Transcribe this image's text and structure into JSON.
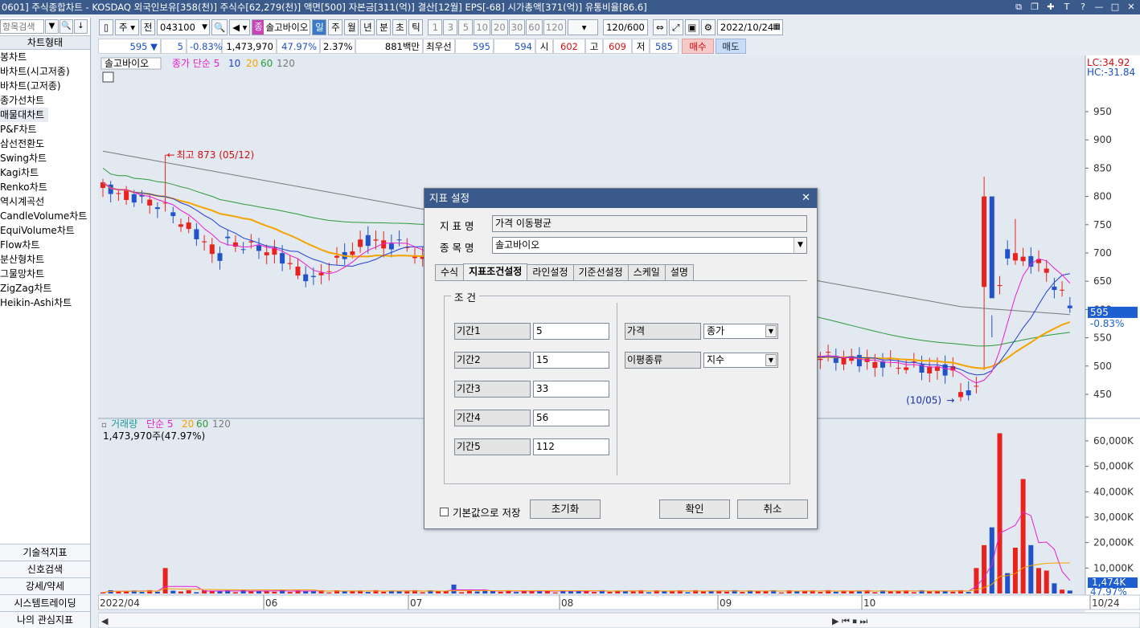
{
  "titlebar": {
    "text": "0601] 주식종합차트 - KOSDAQ 외국인보유[358(천)] 주식수[62,279(천)] 액면[500] 자본금[311(억)] 결산[12월] EPS[-68] 시가총액[371(억)] 유통비율[86.6]",
    "controls": [
      "⧉",
      "❐",
      "✚",
      "T",
      "?",
      "—",
      "□",
      "✕"
    ]
  },
  "sidebar": {
    "search_placeholder": "항목검색",
    "header": "차트형태",
    "items": [
      "봉차트",
      "바차트(시고저종)",
      "바차트(고저종)",
      "종가선차트",
      "매물대차트",
      "P&F차트",
      "삼선전환도",
      "Swing차트",
      "Kagi차트",
      "Renko차트",
      "역시계곡선",
      "CandleVolume차트",
      "EquiVolume차트",
      "Flow차트",
      "분산형차트",
      "그물망차트",
      "ZigZag차트",
      "Heikin-Ashi차트"
    ],
    "selected_index": 4,
    "bottom": [
      "기술적지표",
      "신호검색",
      "강세/약세",
      "시스템트레이딩",
      "나의 관심지표"
    ]
  },
  "toolbar": {
    "period": "주",
    "prev_label": "전",
    "code": "043100",
    "name_badge": "종",
    "stock_name": "솔고바이오",
    "units": [
      "일",
      "주",
      "월",
      "년",
      "분",
      "초",
      "틱"
    ],
    "active_unit": "일",
    "numbers": [
      "1",
      "3",
      "5",
      "10",
      "20",
      "30",
      "60",
      "120"
    ],
    "count": "120",
    "count_total": "/600",
    "date": "2022/10/24"
  },
  "quote": {
    "price": "595",
    "change": "5",
    "change_rate": "-0.83%",
    "volume": "1,473,970",
    "volume_ratio": "47.97%",
    "turnover": "2.37%",
    "amount": "881백만",
    "best_label": "최우선",
    "ask": "595",
    "bid": "594",
    "open_label": "시",
    "open": "602",
    "high_label": "고",
    "high": "609",
    "low_label": "저",
    "low": "585",
    "buy_label": "매수",
    "sell_label": "매도"
  },
  "price_panel": {
    "legend_name": "솔고바이오",
    "legend_ma": "종가 단순 5",
    "legend_periods": [
      "10",
      "20",
      "60",
      "120"
    ],
    "high_annotation": "최고 873 (05/12)",
    "low_annotation": "(10/05)",
    "lc": "LC:34.92",
    "hc": "HC:-31.84",
    "y_ticks": [
      "950",
      "900",
      "850",
      "800",
      "750",
      "700",
      "650",
      "600",
      "550",
      "500",
      "450"
    ],
    "current_price": "595",
    "current_change": "-0.83%"
  },
  "volume_panel": {
    "legend_name": "거래량",
    "legend_ma": "단순 5",
    "legend_periods": [
      "20",
      "60",
      "120"
    ],
    "value": "1,473,970주(47.97%)",
    "y_ticks": [
      "60,000K",
      "50,000K",
      "40,000K",
      "30,000K",
      "20,000K",
      "10,000K"
    ],
    "current": "1,474K",
    "current_ratio": "47.97%"
  },
  "x_axis": [
    "2022/04",
    "06",
    "07",
    "08",
    "09",
    "10",
    "10/24"
  ],
  "colors": {
    "up": "#e8221c",
    "down": "#2152c9",
    "ma5": "#e81ed2",
    "ma10": "#1f3fd6",
    "ma20": "#f5a300",
    "ma60": "#2a9a3a",
    "ma120": "#7a7a7a",
    "title_bar": "#3a5a8c"
  },
  "dialog": {
    "title": "지표 설정",
    "name_label": "지 표 명",
    "name_value": "가격 이동평균",
    "stock_label": "종 목 명",
    "stock_value": "솔고바이오",
    "tabs": [
      "수식",
      "지표조건설정",
      "라인설정",
      "기준선설정",
      "스케일",
      "설명"
    ],
    "active_tab": 1,
    "group_label": "조 건",
    "periods": [
      {
        "label": "기간1",
        "value": "5"
      },
      {
        "label": "기간2",
        "value": "15"
      },
      {
        "label": "기간3",
        "value": "33"
      },
      {
        "label": "기간4",
        "value": "56"
      },
      {
        "label": "기간5",
        "value": "112"
      }
    ],
    "price_label": "가격",
    "price_value": "종가",
    "ma_type_label": "이평종류",
    "ma_type_value": "지수",
    "save_default_label": "기본값으로 저장",
    "reset_label": "초기화",
    "ok_label": "확인",
    "cancel_label": "취소"
  }
}
